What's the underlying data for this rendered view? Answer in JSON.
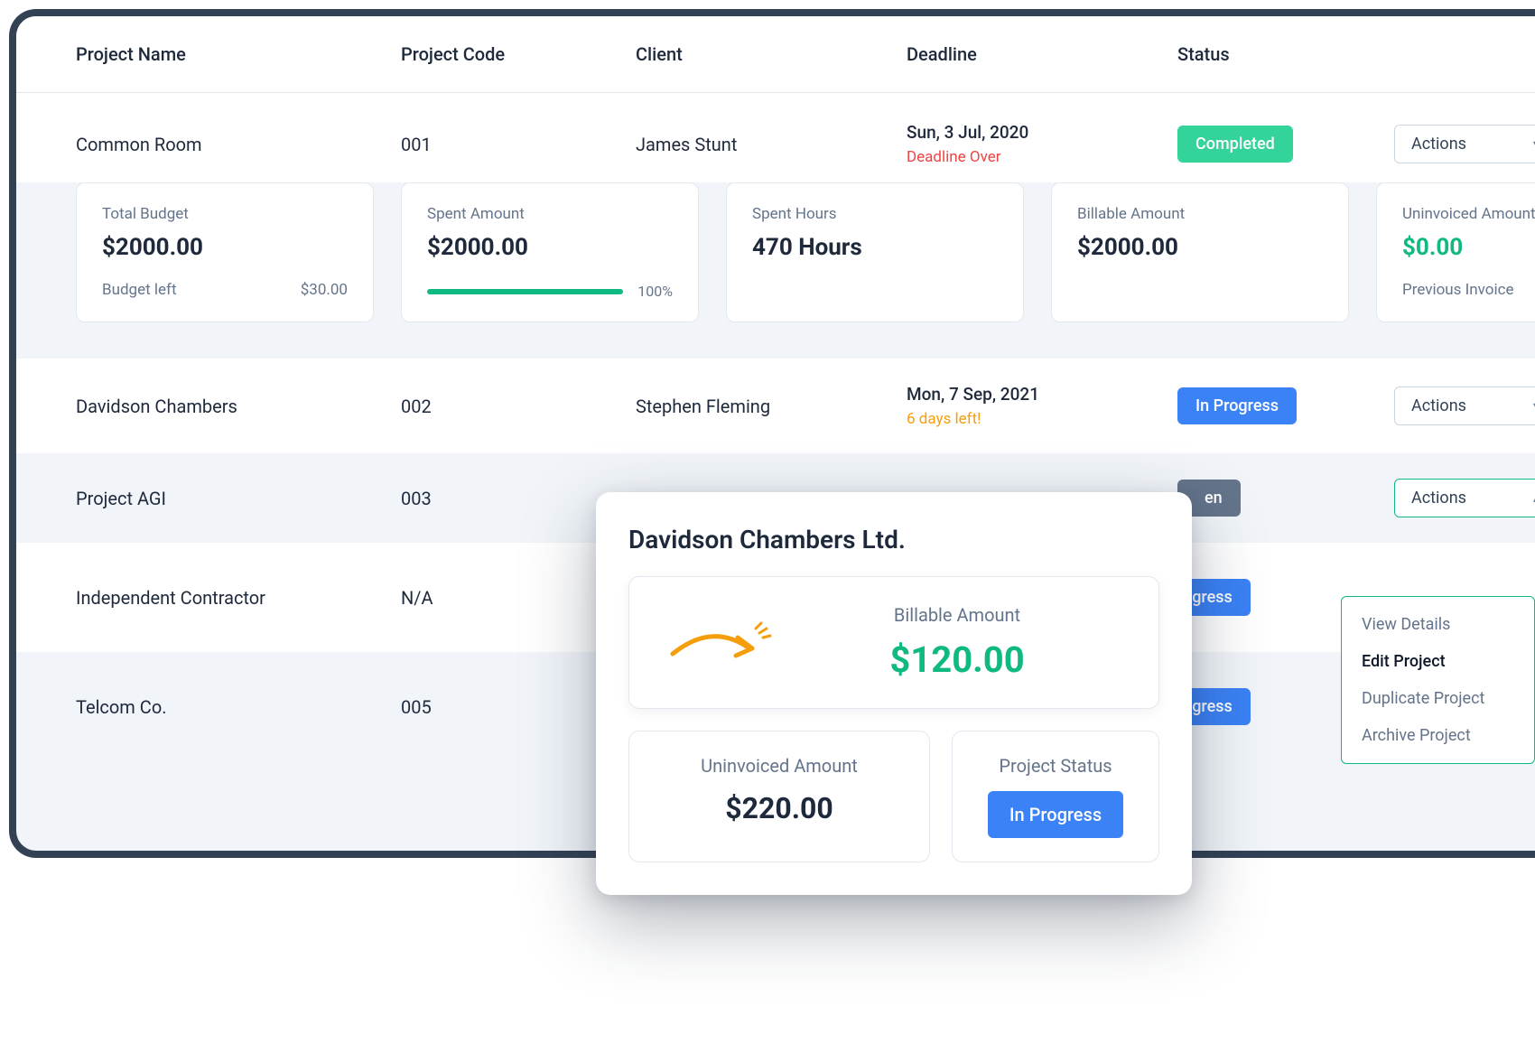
{
  "columns": {
    "name": "Project Name",
    "code": "Project Code",
    "client": "Client",
    "deadline": "Deadline",
    "status": "Status"
  },
  "actions_label": "Actions",
  "status_labels": {
    "completed": "Completed",
    "in_progress": "In Progress",
    "open": "Open"
  },
  "rows": [
    {
      "name": "Common Room",
      "code": "001",
      "client": "James Stunt",
      "deadline_date": "Sun, 3 Jul, 2020",
      "deadline_note": "Deadline Over",
      "deadline_class": "dl-over",
      "status": "completed"
    },
    {
      "name": "Davidson Chambers",
      "code": "002",
      "client": "Stephen Fleming",
      "deadline_date": "Mon, 7 Sep, 2021",
      "deadline_note": "6 days left!",
      "deadline_class": "dl-warn",
      "status": "in_progress"
    },
    {
      "name": "Project AGI",
      "code": "003",
      "client": "",
      "deadline_date": "",
      "deadline_note": "",
      "status": "open"
    },
    {
      "name": "Independent Contractor",
      "code": "N/A",
      "client": "",
      "deadline_date": "",
      "deadline_note": "",
      "status": "in_progress"
    },
    {
      "name": "Telcom Co.",
      "code": "005",
      "client": "",
      "deadline_date": "",
      "deadline_note": "",
      "status": "in_progress"
    }
  ],
  "expanded": {
    "total_budget": {
      "label": "Total Budget",
      "value": "$2000.00",
      "sub_label": "Budget left",
      "sub_value": "$30.00"
    },
    "spent_amount": {
      "label": "Spent Amount",
      "value": "$2000.00",
      "pct": "100%"
    },
    "spent_hours": {
      "label": "Spent Hours",
      "value": "470 Hours"
    },
    "billable": {
      "label": "Billable Amount",
      "value": "$2000.00"
    },
    "uninvoiced": {
      "label": "Uninvoiced Amount",
      "value": "$0.00",
      "sub_label": "Previous Invoice"
    }
  },
  "dropdown": {
    "view": "View Details",
    "edit": "Edit Project",
    "duplicate": "Duplicate Project",
    "archive": "Archive Project"
  },
  "popover": {
    "title": "Davidson Chambers Ltd.",
    "billable_label": "Billable Amount",
    "billable_value": "$120.00",
    "uninvoiced_label": "Uninvoiced Amount",
    "uninvoiced_value": "$220.00",
    "status_label": "Project Status",
    "status_value": "In Progress"
  }
}
